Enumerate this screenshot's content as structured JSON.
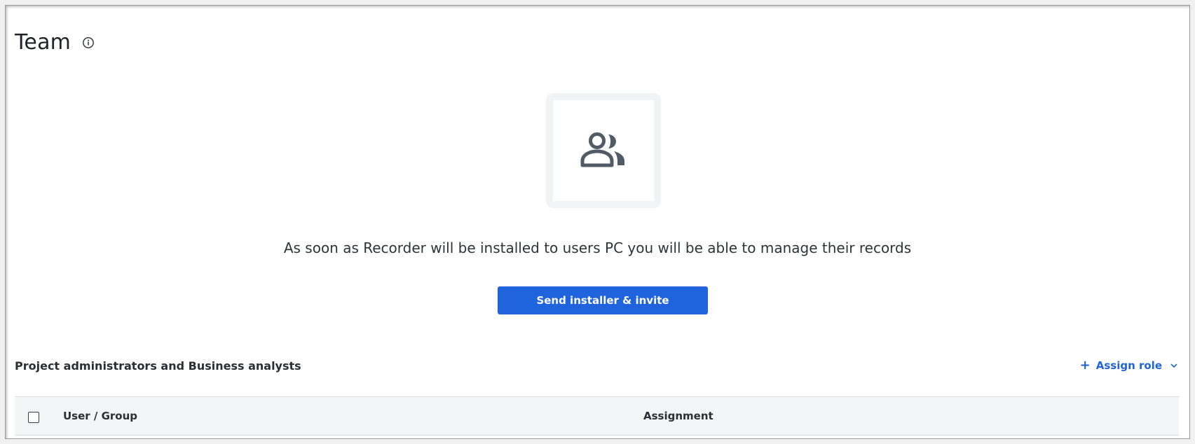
{
  "page": {
    "title": "Team"
  },
  "empty_state": {
    "icon": "users-icon",
    "message": "As soon as Recorder will be installed to users PC you will be able to manage their records",
    "primary_button": "Send installer & invite"
  },
  "section": {
    "title": "Project administrators and Business analysts",
    "assign_role_label": "Assign role"
  },
  "table": {
    "columns": [
      "User / Group",
      "Assignment"
    ]
  },
  "colors": {
    "accent": "#1f63dd",
    "icon": "#515b66",
    "header_bg": "#f4f5f6"
  }
}
